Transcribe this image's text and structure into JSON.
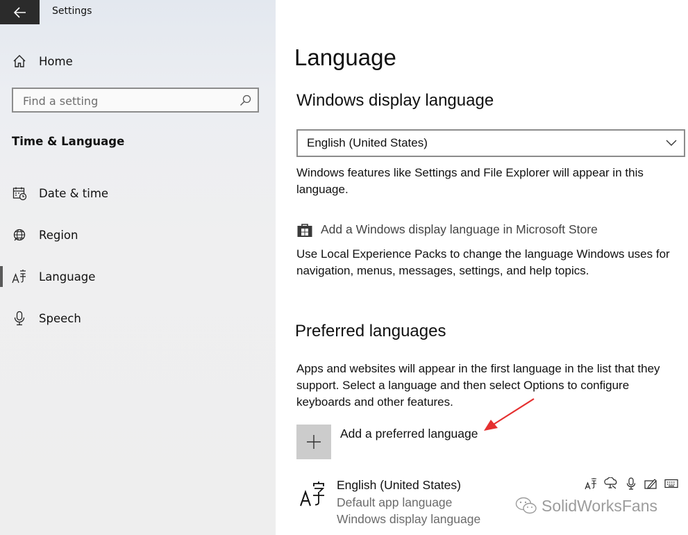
{
  "window": {
    "title": "Settings"
  },
  "sidebar": {
    "home_label": "Home",
    "search": {
      "placeholder": "Find a setting"
    },
    "section_title": "Time & Language",
    "items": [
      {
        "label": "Date & time",
        "icon": "calendar-clock-icon"
      },
      {
        "label": "Region",
        "icon": "globe-icon"
      },
      {
        "label": "Language",
        "icon": "language-icon",
        "active": true
      },
      {
        "label": "Speech",
        "icon": "microphone-icon"
      }
    ]
  },
  "main": {
    "title": "Language",
    "display_language": {
      "heading": "Windows display language",
      "selected": "English (United States)",
      "description": "Windows features like Settings and File Explorer will appear in this language.",
      "store_link": "Add a Windows display language in Microsoft Store",
      "lxp_description": "Use Local Experience Packs to change the language Windows uses for navigation, menus, messages, settings, and help topics."
    },
    "preferred": {
      "heading": "Preferred languages",
      "description": "Apps and websites will appear in the first language in the list that they support. Select a language and then select Options to configure keyboards and other features.",
      "add_label": "Add a preferred language",
      "languages": [
        {
          "name": "English (United States)",
          "sub1": "Default app language",
          "sub2": "Windows display language",
          "feature_icons": [
            "language-pack-icon",
            "speech-icon",
            "microphone-icon",
            "handwriting-icon",
            "keyboard-icon"
          ]
        }
      ]
    }
  },
  "watermark": {
    "text": "SolidWorksFans"
  },
  "colors": {
    "back_button": "#2b2b2b",
    "add_tile": "#cccccc",
    "annotation_arrow": "#e53030"
  }
}
